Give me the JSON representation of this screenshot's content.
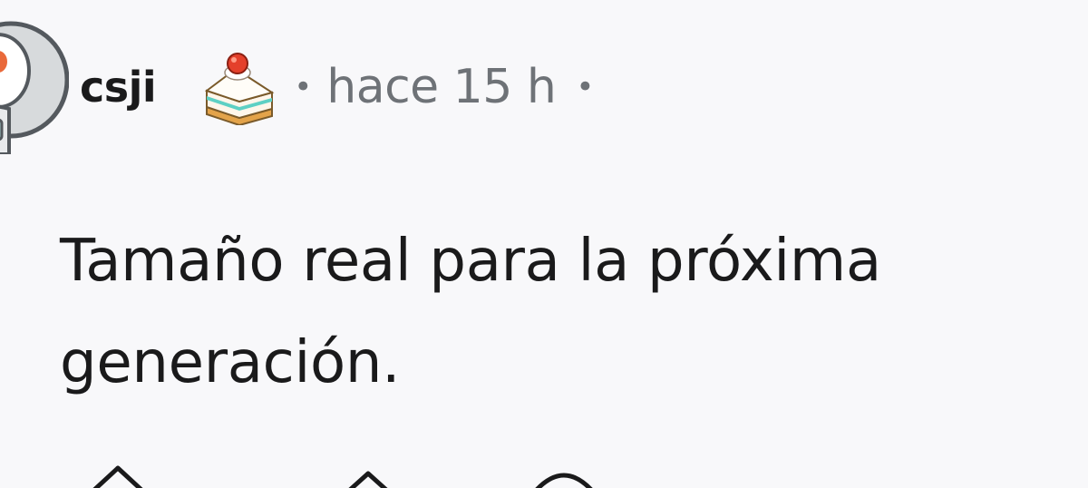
{
  "comment": {
    "author": "csji",
    "flair_icon": "cake-icon",
    "separator": "•",
    "timestamp": "hace 15 h",
    "body_line1": "Tamaño real para la próxima",
    "body_line2": "generación."
  },
  "actions": {
    "icons": [
      "upvote-icon",
      "reply-icon",
      "share-icon"
    ]
  },
  "colors": {
    "background": "#f8f8fa",
    "text": "#1a1a1b",
    "meta": "#6e7277"
  }
}
